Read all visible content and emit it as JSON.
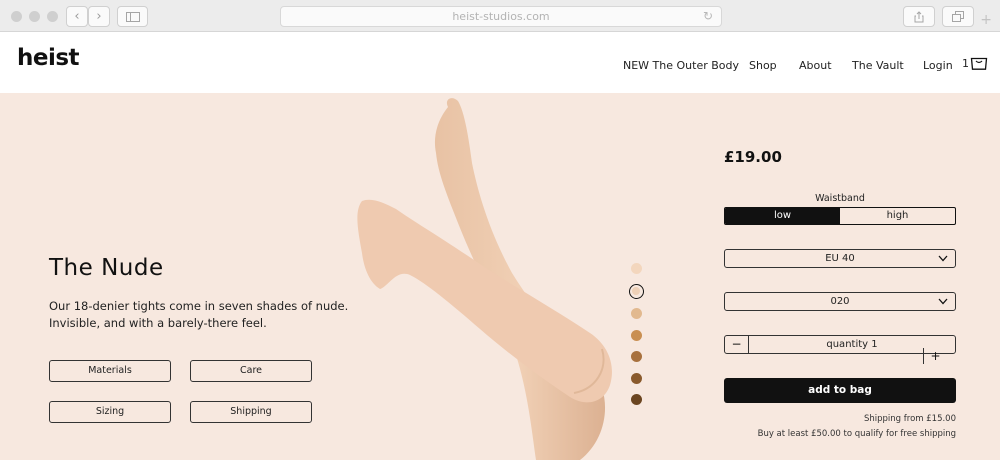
{
  "browser": {
    "url": "heist-studios.com",
    "back_glyph": "‹",
    "forward_glyph": "›",
    "reload_glyph": "↻",
    "new_tab_glyph": "+"
  },
  "header": {
    "logo": "heist",
    "nav": [
      {
        "label": "NEW The Outer Body"
      },
      {
        "label": "Shop"
      },
      {
        "label": "About"
      },
      {
        "label": "The Vault"
      },
      {
        "label": "Login"
      }
    ],
    "cart_count": "1",
    "cart_icon": "shopping-bag-icon"
  },
  "product": {
    "title": "The Nude",
    "description": "Our 18-denier tights come in seven shades of nude. Invisible, and with a barely-there feel.",
    "info_buttons": [
      {
        "label": "Materials"
      },
      {
        "label": "Care"
      },
      {
        "label": "Sizing"
      },
      {
        "label": "Shipping"
      }
    ],
    "swatches": [
      {
        "color": "#f3d6bd",
        "selected": false
      },
      {
        "color": "#eed1b8",
        "selected": true
      },
      {
        "color": "#e2b98f",
        "selected": false
      },
      {
        "color": "#c98f52",
        "selected": false
      },
      {
        "color": "#a8713e",
        "selected": false
      },
      {
        "color": "#8a5a2c",
        "selected": false
      },
      {
        "color": "#6b4520",
        "selected": false
      }
    ],
    "price": "£19.00",
    "waistband": {
      "label": "Waistband",
      "options": [
        "low",
        "high"
      ],
      "selected": "low"
    },
    "size_select": "EU 40",
    "color_select": "020",
    "quantity": {
      "minus": "−",
      "label": "quantity 1",
      "plus": "+"
    },
    "add_to_bag": "add to bag",
    "shipping_note_1": "Shipping from £15.00",
    "shipping_note_2": "Buy at least £50.00 to qualify for free shipping"
  },
  "colors": {
    "hero_background": "#f7e8df",
    "accent": "#111111"
  }
}
